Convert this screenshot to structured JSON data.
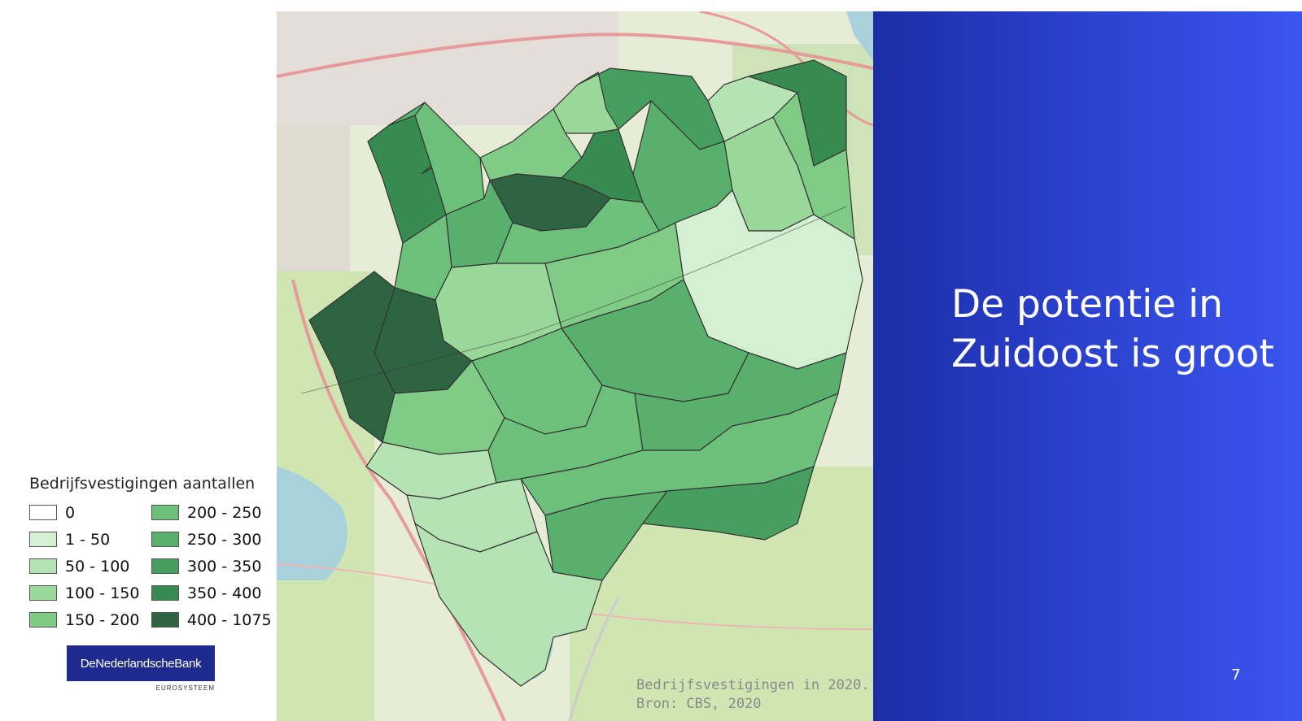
{
  "legend": {
    "title": "Bedrijfsvestigingen aantallen",
    "items": [
      {
        "label": "0",
        "color": "#ffffff"
      },
      {
        "label": "1 - 50",
        "color": "#d4efd2"
      },
      {
        "label": "50 - 100",
        "color": "#b6e3b4"
      },
      {
        "label": "100 - 150",
        "color": "#9ad89a"
      },
      {
        "label": "150 - 200",
        "color": "#80cc86"
      },
      {
        "label": "200 - 250",
        "color": "#6cc07a"
      },
      {
        "label": "250 - 300",
        "color": "#58b06c"
      },
      {
        "label": "300 - 350",
        "color": "#479f5f"
      },
      {
        "label": "350 - 400",
        "color": "#388b50"
      },
      {
        "label": "400 - 1075",
        "color": "#2e6441"
      }
    ]
  },
  "map": {
    "source_line1": "Bedrijfsvestigingen in 2020.",
    "source_line2": "Bron: CBS, 2020"
  },
  "logo": {
    "name": "DeNederlandscheBank",
    "subtitle": "EUROSYSTEEM",
    "color": "#1f2a8f"
  },
  "slide": {
    "title": "De potentie in Zuidoost is groot",
    "page_number": "7"
  }
}
